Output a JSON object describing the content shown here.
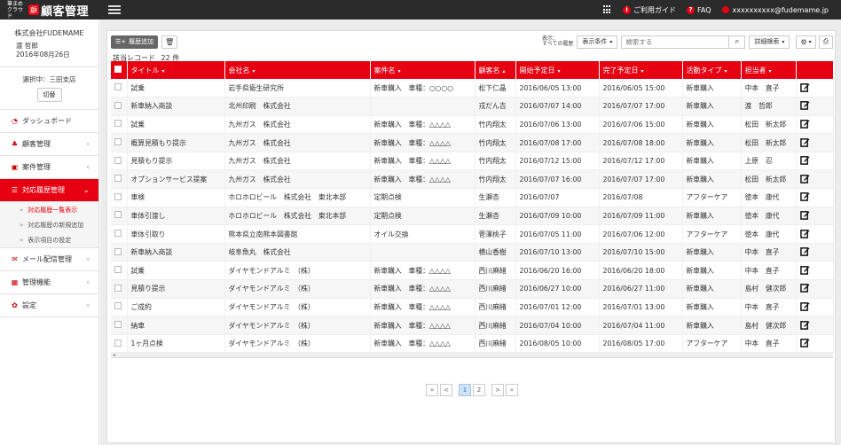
{
  "app": {
    "logo_small": "筆まめクラウド",
    "logo_mark": "顧",
    "logo_name": "顧客管理"
  },
  "topbar": {
    "guide": "ご利用ガイド",
    "faq": "FAQ",
    "user_email": "xxxxxxxxxx@fudemame.jp"
  },
  "sidebar": {
    "company": "株式会社FUDEMAME",
    "user_name": "渡 哲郎",
    "date": "2016年08月26日",
    "branch": "選択中：三田支店",
    "switch": "切替",
    "menu": [
      {
        "label": "ダッシュボード",
        "icon": "dashboard-icon"
      },
      {
        "label": "顧客管理",
        "icon": "users-icon"
      },
      {
        "label": "案件管理",
        "icon": "case-icon"
      },
      {
        "label": "対応履歴管理",
        "icon": "history-icon"
      },
      {
        "label": "メール配信管理",
        "icon": "mail-icon"
      },
      {
        "label": "管理機能",
        "icon": "admin-icon"
      },
      {
        "label": "設定",
        "icon": "gear-icon"
      }
    ],
    "submenu": [
      "対応履歴一覧表示",
      "対応履歴の新規追加",
      "表示項目の設定"
    ]
  },
  "toolbar": {
    "add_label": "履歴追加",
    "view_label_1": "表示：",
    "view_label_2": "すべての履歴",
    "condition": "表示条件",
    "search_placeholder": "検索する",
    "advanced": "詳細検索"
  },
  "count_label": "該当レコード",
  "count_value": "22 件",
  "table": {
    "headers": [
      "タイトル",
      "会社名",
      "案件名",
      "顧客名",
      "開始予定日",
      "完了予定日",
      "活動タイプ",
      "担当者"
    ],
    "rows": [
      [
        "試乗",
        "岩手県衛生研究所",
        "新車購入　車種：○○○○",
        "松下仁晶",
        "2016/06/05 13:00",
        "2016/06/05 15:00",
        "新車購入",
        "中本　直子"
      ],
      [
        "新車納入商談",
        "北州印刷　株式会社",
        "",
        "戎だん吉",
        "2016/07/07 14:00",
        "2016/07/07 17:00",
        "新車購入",
        "渡　哲郎"
      ],
      [
        "試乗",
        "九州ガス　株式会社",
        "新車購入　車種：△△△△",
        "竹内翔太",
        "2016/07/06 13:00",
        "2016/07/06 15:00",
        "新車購入",
        "松田　新太郎"
      ],
      [
        "概算見積もり提示",
        "九州ガス　株式会社",
        "新車購入　車種：△△△△",
        "竹内翔太",
        "2016/07/08 17:00",
        "2016/07/08 18:00",
        "新車購入",
        "松田　新太郎"
      ],
      [
        "見積もり提示",
        "九州ガス　株式会社",
        "新車購入　車種：△△△△",
        "竹内翔太",
        "2016/07/12 15:00",
        "2016/07/12 17:00",
        "新車購入",
        "上原　忍"
      ],
      [
        "オプションサービス提案",
        "九州ガス　株式会社",
        "新車購入　車種：△△△△",
        "竹内翔太",
        "2016/07/07 16:00",
        "2016/07/07 17:00",
        "新車購入",
        "松田　新太郎"
      ],
      [
        "車検",
        "ホロホロビール　株式会社　東北本部",
        "定期点検",
        "生瀬杏",
        "2016/07/07",
        "2016/07/08",
        "アフターケア",
        "徳本　康代"
      ],
      [
        "車体引渡し",
        "ホロホロビール　株式会社　東北本部",
        "定期点検",
        "生瀬杏",
        "2016/07/09 10:00",
        "2016/07/09 11:00",
        "新車購入",
        "徳本　康代"
      ],
      [
        "車体引取り",
        "熊本県立南熊本図書館",
        "オイル交換",
        "菅澤桃子",
        "2016/07/05 11:00",
        "2016/07/06 12:00",
        "アフターケア",
        "徳本　康代"
      ],
      [
        "新車納入商談",
        "岐阜魚丸　株式会社",
        "",
        "横山香樹",
        "2016/07/10 13:00",
        "2016/07/10 15:00",
        "新車購入",
        "中本　直子"
      ],
      [
        "試乗",
        "ダイヤモンドアルミ　（株）",
        "新車購入　車種：△△△△",
        "西川麻緒",
        "2016/06/20 16:00",
        "2016/06/20 18:00",
        "新車購入",
        "中本　直子"
      ],
      [
        "見積り提示",
        "ダイヤモンドアルミ　（株）",
        "新車購入　車種：△△△△",
        "西川麻緒",
        "2016/06/27 10:00",
        "2016/06/27 11:00",
        "新車購入",
        "島村　健次郎"
      ],
      [
        "ご成約",
        "ダイヤモンドアルミ　（株）",
        "新車購入　車種：△△△△",
        "西川麻緒",
        "2016/07/01 12:00",
        "2016/07/01 13:00",
        "新車購入",
        "中本　直子"
      ],
      [
        "納車",
        "ダイヤモンドアルミ　（株）",
        "新車購入　車種：△△△△",
        "西川麻緒",
        "2016/07/04 10:00",
        "2016/07/04 11:00",
        "新車購入",
        "島村　健次郎"
      ],
      [
        "1ヶ月点検",
        "ダイヤモンドアルミ　（株）",
        "新車購入　車種：△△△△",
        "西川麻緒",
        "2016/08/05 10:00",
        "2016/08/05 17:00",
        "アフターケア",
        "中本　直子"
      ]
    ]
  },
  "pagination": {
    "first": "«",
    "prev": "<",
    "pages": [
      "1",
      "2"
    ],
    "next": ">",
    "last": "»"
  },
  "colors": {
    "accent": "#e60012",
    "topbar": "#2b2b2b"
  }
}
